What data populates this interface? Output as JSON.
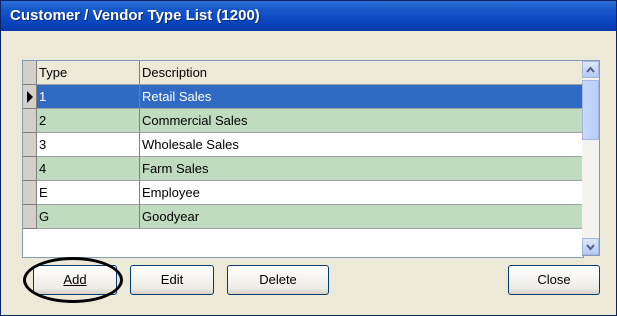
{
  "window": {
    "title": "Customer / Vendor Type List (1200)"
  },
  "grid": {
    "columns": [
      "Type",
      "Description"
    ],
    "rows": [
      {
        "type": "1",
        "description": "Retail Sales",
        "selected": true
      },
      {
        "type": "2",
        "description": "Commercial Sales",
        "selected": false
      },
      {
        "type": "3",
        "description": "Wholesale Sales",
        "selected": false
      },
      {
        "type": "4",
        "description": "Farm Sales",
        "selected": false
      },
      {
        "type": "E",
        "description": "Employee",
        "selected": false
      },
      {
        "type": "G",
        "description": "Goodyear",
        "selected": false
      }
    ]
  },
  "buttons": {
    "add": "Add",
    "edit": "Edit",
    "delete": "Delete",
    "close": "Close"
  },
  "colors": {
    "selected_row": "#316ac5",
    "alt_row": "#c0dcc0",
    "row_text_selected": "#ffffff"
  }
}
